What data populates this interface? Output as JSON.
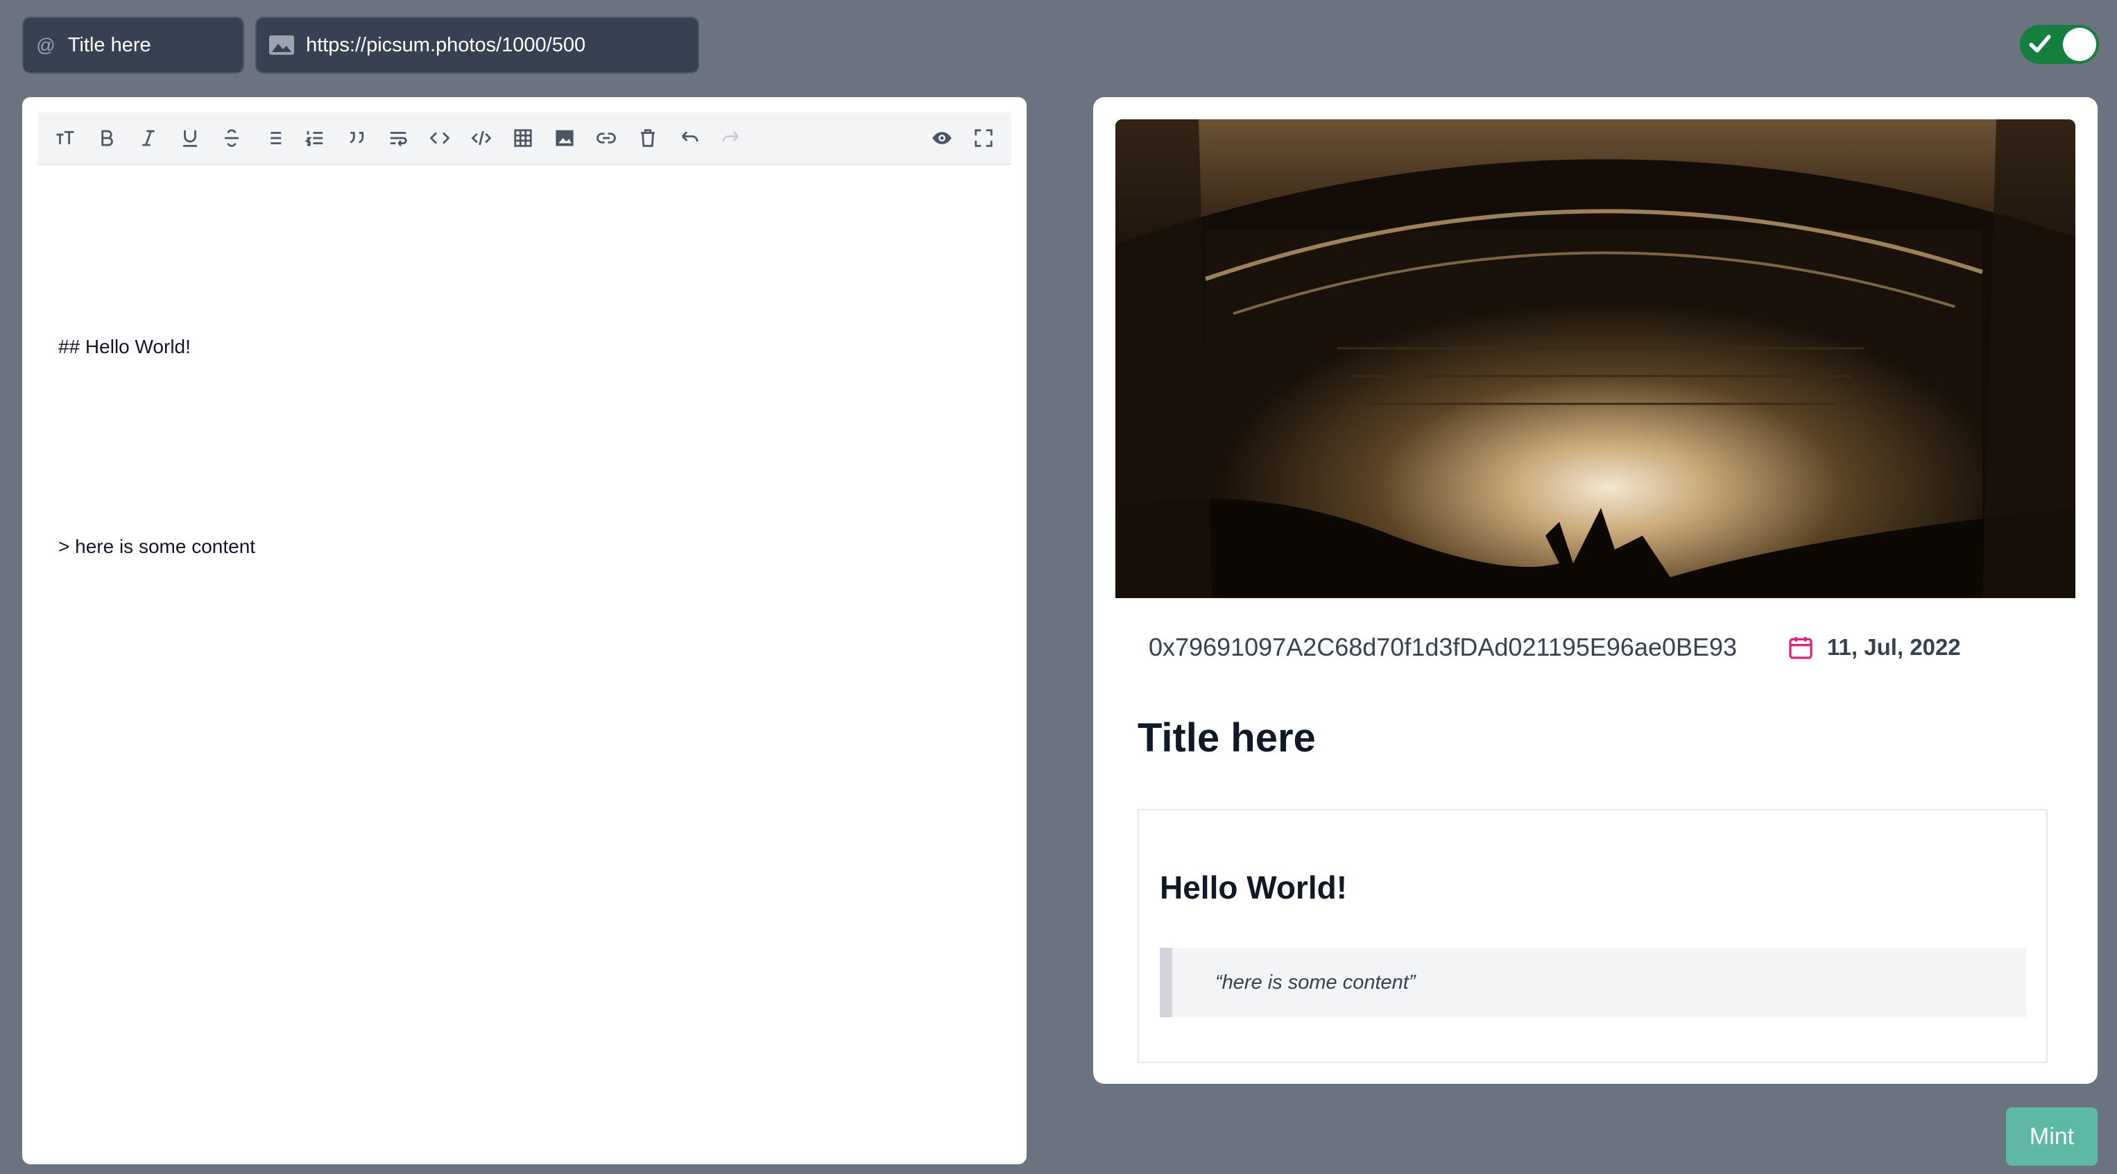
{
  "header": {
    "title_input": {
      "value": "Title here",
      "prefix_icon": "at-icon"
    },
    "image_url_input": {
      "value": "https://picsum.photos/1000/500",
      "prefix_icon": "image-icon"
    },
    "toggle": {
      "state": "on",
      "color": "#15803d"
    }
  },
  "editor": {
    "toolbar": [
      "heading",
      "bold",
      "italic",
      "underline",
      "strikethrough",
      "unordered-list",
      "ordered-list",
      "quote",
      "wrap",
      "code-inline",
      "code-block",
      "table",
      "image",
      "link",
      "delete",
      "undo",
      "redo",
      "preview",
      "fullscreen"
    ],
    "content_lines": [
      "## Hello World!",
      "",
      "> here is some content"
    ]
  },
  "preview": {
    "hero_alt": "concert",
    "address": "0x79691097A2C68d70f1d3fDAd021195E96ae0BE93",
    "date": "11, Jul, 2022",
    "title": "Title here",
    "content_heading": "Hello World!",
    "blockquote": "“here is some content”"
  },
  "actions": {
    "mint_label": "Mint",
    "mint_color": "#5eb8a6"
  }
}
